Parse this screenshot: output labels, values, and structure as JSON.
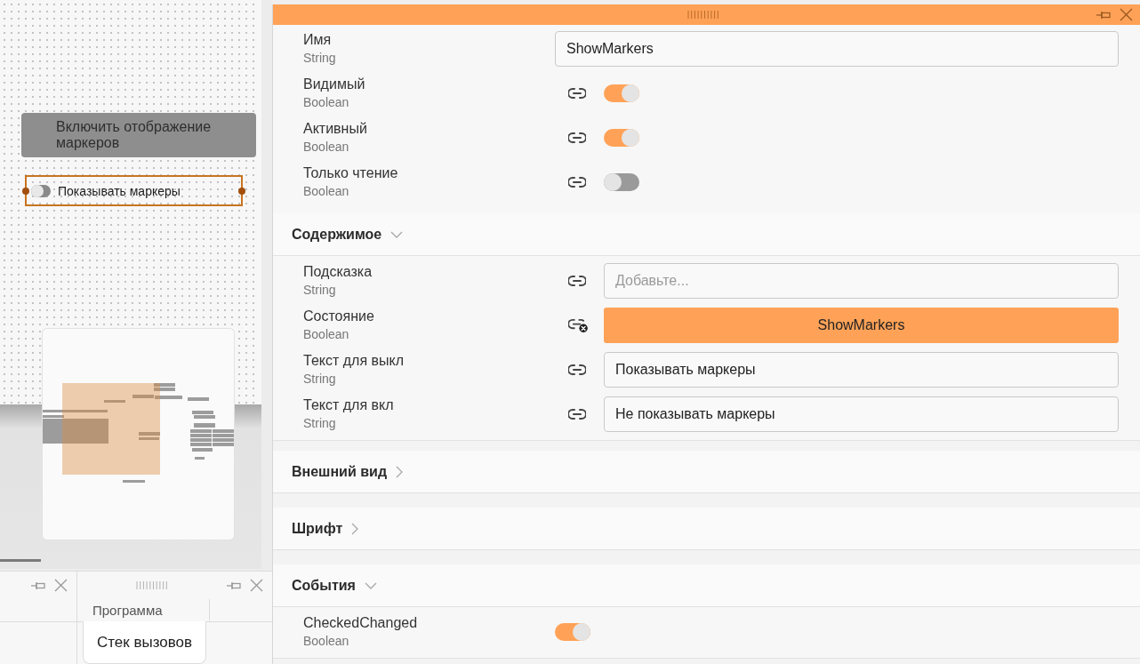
{
  "canvas": {
    "button": {
      "label": "Включить отображение маркеров"
    },
    "switch": {
      "label": "Показывать маркеры",
      "on": false,
      "selected": true
    }
  },
  "docks": {
    "tabs": [
      {
        "label": "Программа",
        "selected": false
      },
      {
        "label": "Стек вызовов",
        "selected": true
      }
    ]
  },
  "properties": {
    "rows": [
      {
        "kind": "text",
        "name": "Имя",
        "type": "String",
        "bindable": false,
        "value": "ShowMarkers"
      },
      {
        "kind": "switch",
        "name": "Видимый",
        "type": "Boolean",
        "bindable": true,
        "on": true
      },
      {
        "kind": "switch",
        "name": "Активный",
        "type": "Boolean",
        "bindable": true,
        "on": true
      },
      {
        "kind": "switch",
        "name": "Только чтение",
        "type": "Boolean",
        "bindable": true,
        "on": false
      }
    ],
    "sections": [
      {
        "title": "Содержимое",
        "expanded": true,
        "rows": [
          {
            "kind": "text",
            "name": "Подсказка",
            "type": "String",
            "bindable": true,
            "placeholder": "Добавьте..."
          },
          {
            "kind": "binding",
            "name": "Состояние",
            "type": "Boolean",
            "bindable": true,
            "value": "ShowMarkers"
          },
          {
            "kind": "text",
            "name": "Текст для выкл",
            "type": "String",
            "bindable": true,
            "value": "Показывать маркеры"
          },
          {
            "kind": "text",
            "name": "Текст для вкл",
            "type": "String",
            "bindable": true,
            "value": "Не показывать маркеры"
          }
        ]
      },
      {
        "title": "Внешний вид",
        "expanded": false
      },
      {
        "title": "Шрифт",
        "expanded": false
      },
      {
        "title": "События",
        "expanded": true,
        "rows": [
          {
            "kind": "switch",
            "name": "CheckedChanged",
            "type": "Boolean",
            "bindable": false,
            "on": true
          }
        ]
      }
    ]
  }
}
